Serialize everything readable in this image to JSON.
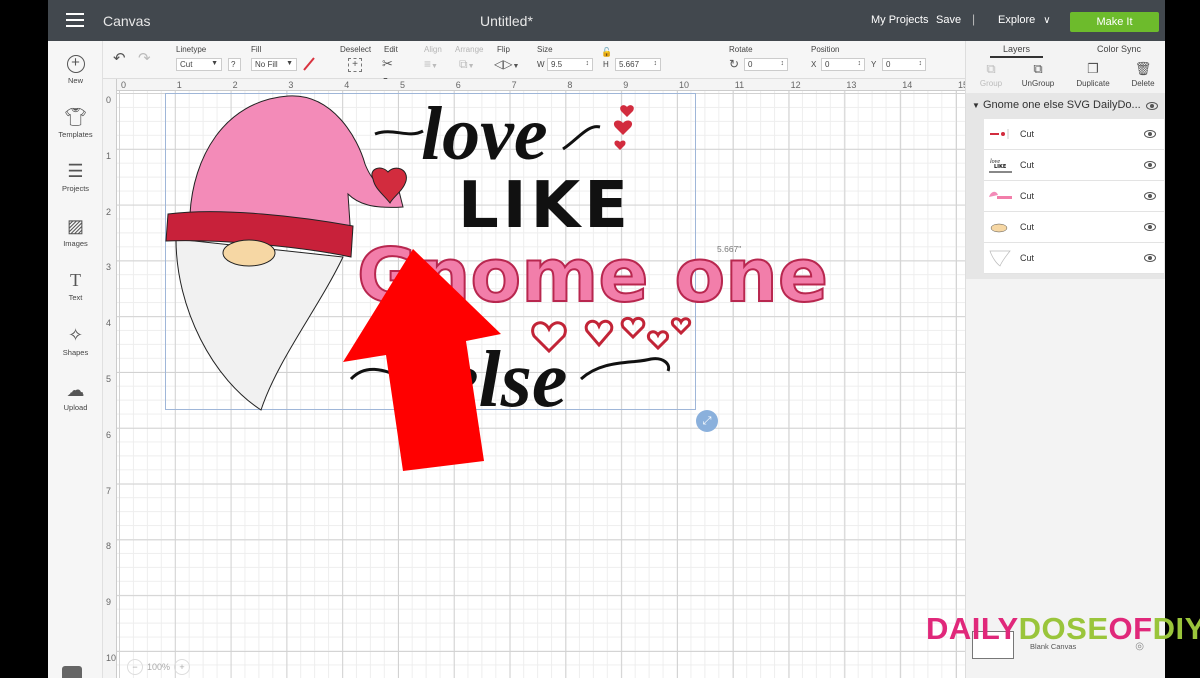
{
  "header": {
    "app_title": "Canvas",
    "doc_title": "Untitled*",
    "my_projects": "My Projects",
    "save": "Save",
    "separator": "|",
    "explore": "Explore",
    "make_it": "Make It",
    "colors": {
      "bar": "#42484e",
      "make_it": "#6dbb2c"
    }
  },
  "toolbar": {
    "linetype_label": "Linetype",
    "linetype_value": "Cut",
    "help": "?",
    "fill_label": "Fill",
    "fill_value": "No Fill",
    "deselect_label": "Deselect",
    "edit_label": "Edit",
    "align_label": "Align",
    "arrange_label": "Arrange",
    "flip_label": "Flip",
    "size_label": "Size",
    "w_label": "W",
    "w_value": "9.5",
    "h_label": "H",
    "h_value": "5.667",
    "rotate_label": "Rotate",
    "rotate_value": "0",
    "position_label": "Position",
    "x_label": "X",
    "x_value": "0",
    "y_label": "Y",
    "y_value": "0"
  },
  "sidebar": {
    "items": [
      {
        "label": "New",
        "icon": "plus-circle-icon"
      },
      {
        "label": "Templates",
        "icon": "shirt-icon"
      },
      {
        "label": "Projects",
        "icon": "notebook-icon"
      },
      {
        "label": "Images",
        "icon": "image-icon"
      },
      {
        "label": "Text",
        "icon": "text-icon"
      },
      {
        "label": "Shapes",
        "icon": "shapes-icon"
      },
      {
        "label": "Upload",
        "icon": "cloud-upload-icon"
      }
    ]
  },
  "canvas": {
    "ruler_top": [
      "0",
      "1",
      "2",
      "3",
      "4",
      "5",
      "6",
      "7",
      "8",
      "9",
      "10",
      "11",
      "12",
      "13",
      "14",
      "15"
    ],
    "ruler_left": [
      "0",
      "1",
      "2",
      "3",
      "4",
      "5",
      "6",
      "7",
      "8",
      "9",
      "10"
    ],
    "height_readout": "5.667\"",
    "zoom": "100%",
    "design_text": {
      "line1": "love",
      "line2": "LIKE",
      "line3": "Gnome one",
      "line4": "else"
    },
    "colors": {
      "hat": "#f38bb8",
      "hat_band": "#c8213a",
      "heart": "#d22c3e",
      "beard": "#f1f1f1",
      "nose": "#f6d7a4",
      "arrow": "#ff0000",
      "gnome_text": "#f27eaa",
      "selection": "#9fb6d8"
    }
  },
  "panel": {
    "tab_layers": "Layers",
    "tab_color_sync": "Color Sync",
    "actions": [
      {
        "label": "Group",
        "icon": "group-icon",
        "enabled": false
      },
      {
        "label": "UnGroup",
        "icon": "ungroup-icon",
        "enabled": true
      },
      {
        "label": "Duplicate",
        "icon": "duplicate-icon",
        "enabled": true
      },
      {
        "label": "Delete",
        "icon": "trash-icon",
        "enabled": true
      }
    ],
    "group_name": "Gnome one else SVG DailyDo...",
    "layers": [
      {
        "name": "Cut"
      },
      {
        "name": "Cut"
      },
      {
        "name": "Cut"
      },
      {
        "name": "Cut"
      },
      {
        "name": "Cut"
      }
    ],
    "blank_canvas": "Blank Canvas"
  },
  "watermark": {
    "part1": "DAILY",
    "part2": "DOSE",
    "part3": "OF",
    "part4": "DIY",
    "colors": {
      "pink": "#e0287a",
      "green": "#9ac53b"
    }
  }
}
